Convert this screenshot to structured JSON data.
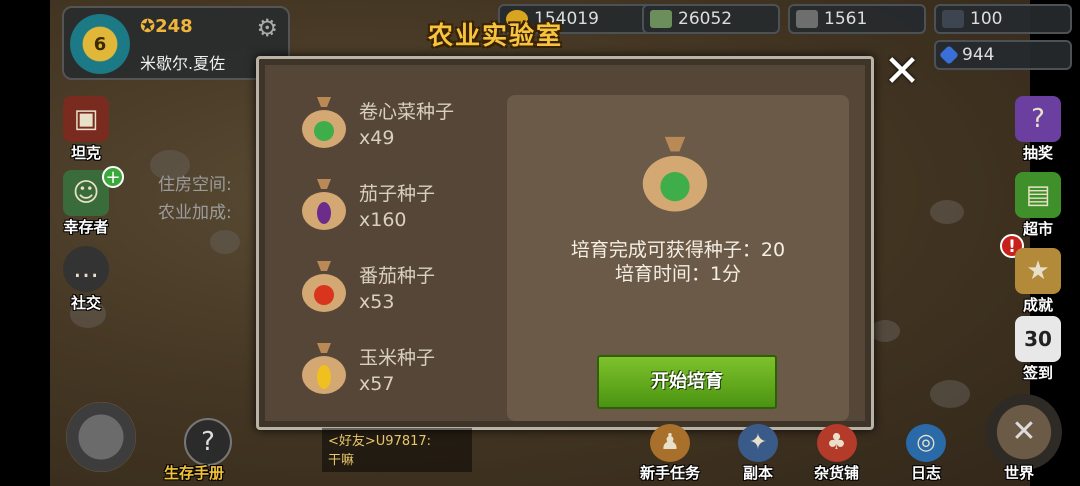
{
  "player": {
    "level": "6",
    "stars": "248",
    "name": "米歇尔.夏佐"
  },
  "currencies": {
    "gold": "154019",
    "cash": "26052",
    "iron": "1561",
    "steel": "100",
    "gems": "944"
  },
  "left_menu": [
    {
      "label": "坦克",
      "icon": "tank-icon"
    },
    {
      "label": "幸存者",
      "icon": "survivor-icon"
    },
    {
      "label": "社交",
      "icon": "chat-bubble-icon"
    }
  ],
  "background_text": {
    "housing": "住房空间:",
    "farm_bonus": "农业加成:"
  },
  "right_menu": [
    {
      "label": "抽奖",
      "icon": "gift-box-icon"
    },
    {
      "label": "超市",
      "icon": "shop-crate-icon"
    },
    {
      "label": "成就",
      "icon": "star-trophy-icon"
    },
    {
      "label": "签到",
      "icon": "calendar-icon",
      "day": "30"
    }
  ],
  "dialog": {
    "title": "农业实验室",
    "close": "✕",
    "seeds": [
      {
        "name": "卷心菜种子",
        "count": "x49",
        "color": "#3fae4a",
        "icon": "cabbage-seed-bag-icon"
      },
      {
        "name": "茄子种子",
        "count": "x160",
        "color": "#6b2c8c",
        "icon": "eggplant-seed-bag-icon"
      },
      {
        "name": "番茄种子",
        "count": "x53",
        "color": "#d8341e",
        "icon": "tomato-seed-bag-icon"
      },
      {
        "name": "玉米种子",
        "count": "x57",
        "color": "#f0c020",
        "icon": "corn-seed-bag-icon"
      }
    ],
    "selected": {
      "reward_text": "培育完成可获得种子：20",
      "time_text": "培育时间：1分",
      "icon": "cabbage-seed-bag-icon"
    },
    "start_button": "开始培育"
  },
  "chat": {
    "line1": "<好友>U97817:",
    "line2": "干嘛"
  },
  "bottom_menu": [
    {
      "label": "生存手册",
      "icon": "question-icon"
    },
    {
      "label": "新手任务",
      "icon": "quest-icon"
    },
    {
      "label": "副本",
      "icon": "dungeon-icon"
    },
    {
      "label": "杂货铺",
      "icon": "grocery-icon"
    },
    {
      "label": "日志",
      "icon": "log-icon"
    },
    {
      "label": "世界",
      "icon": "world-icon"
    }
  ],
  "colors": {
    "accent_gold": "#f7c440",
    "button_green": "#5aa31a",
    "dialog_bg": "#564637"
  }
}
